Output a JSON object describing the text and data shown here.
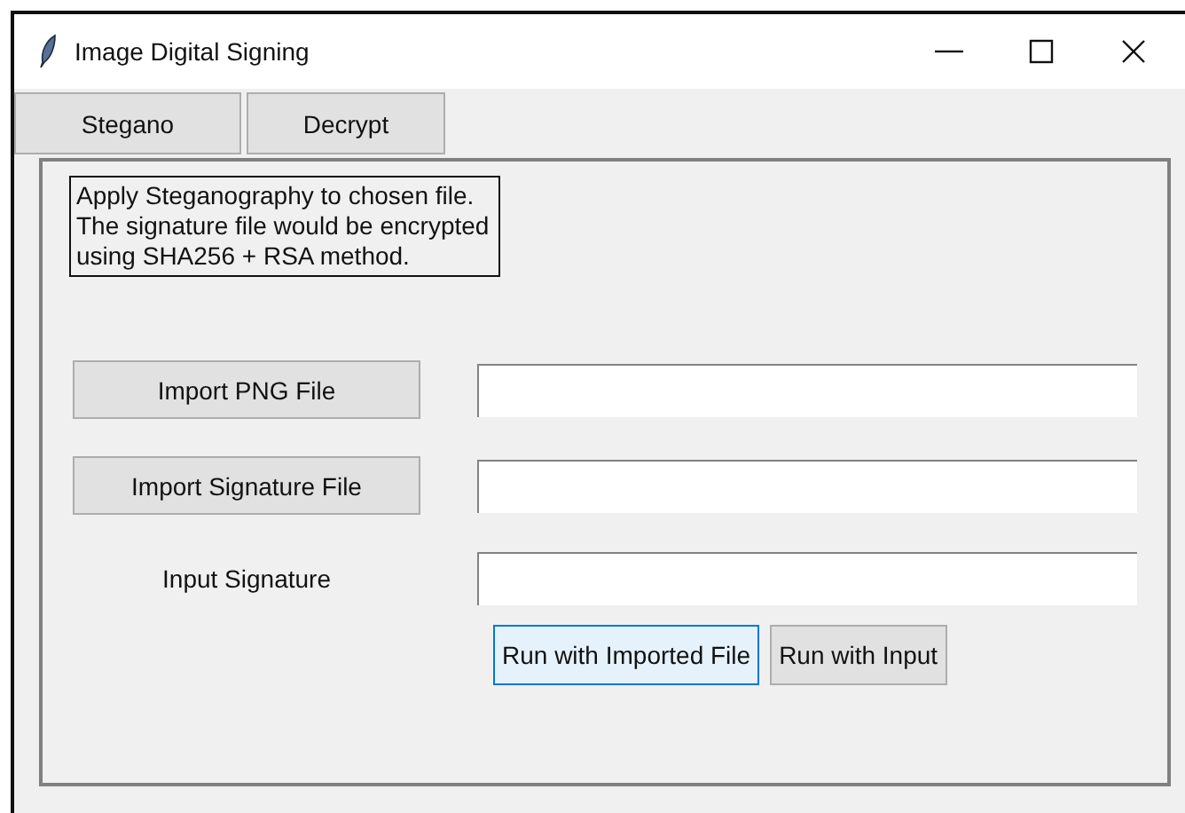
{
  "window": {
    "title": "Image Digital Signing"
  },
  "tabs": [
    {
      "label": "Stegano"
    },
    {
      "label": "Decrypt"
    }
  ],
  "description": "Apply Steganography to chosen file.\nThe signature file would be encrypted\nusing SHA256 + RSA method.",
  "rows": [
    {
      "kind": "button",
      "label": "Import PNG File"
    },
    {
      "kind": "button",
      "label": "Import Signature File"
    },
    {
      "kind": "label",
      "label": "Input Signature"
    }
  ],
  "actions": [
    {
      "label": "Run with Imported File",
      "focused": true
    },
    {
      "label": "Run with Input",
      "focused": false
    }
  ]
}
